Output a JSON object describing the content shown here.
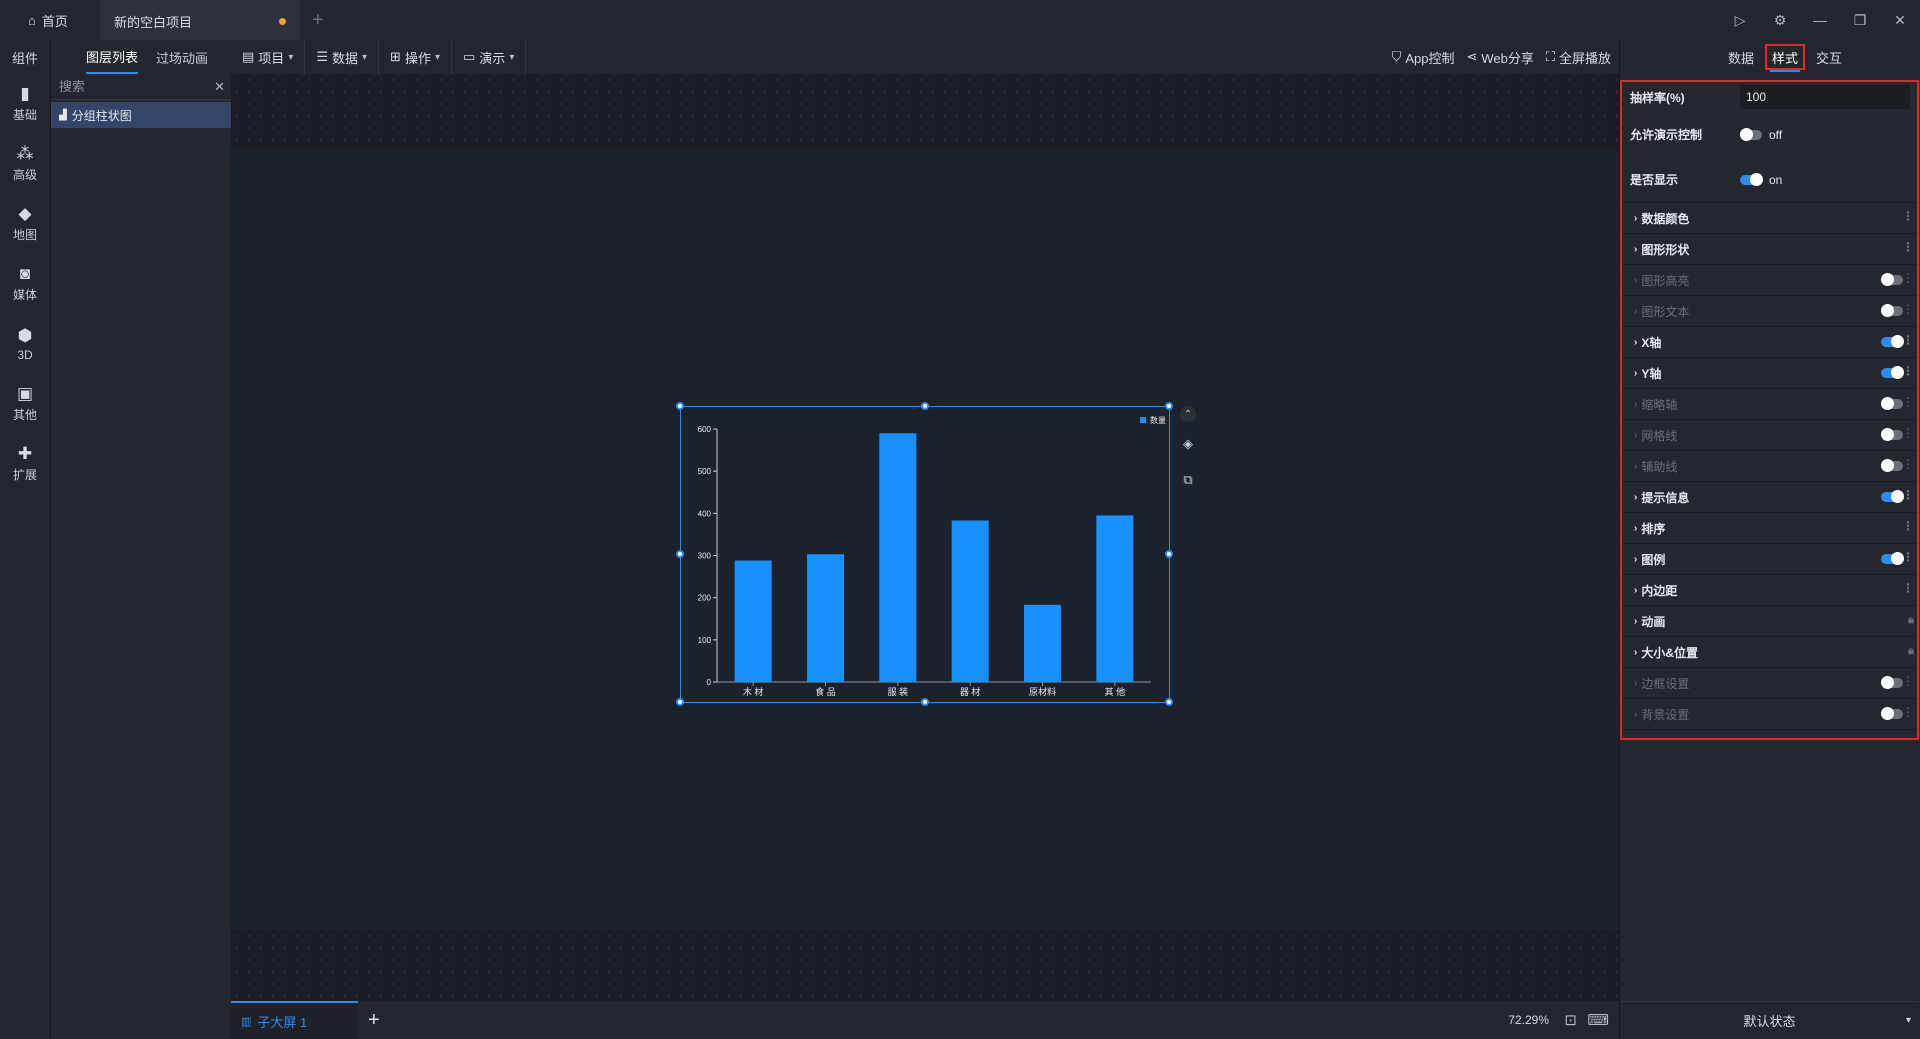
{
  "titlebar": {
    "home_label": "首页",
    "project_label": "新的空白项目",
    "add_tab": "+"
  },
  "leftbar": {
    "title": "组件",
    "items": [
      {
        "label": "基础",
        "icon": "bar-chart-icon"
      },
      {
        "label": "高级",
        "icon": "scatter-icon"
      },
      {
        "label": "地图",
        "icon": "map-icon"
      },
      {
        "label": "媒体",
        "icon": "camera-icon"
      },
      {
        "label": "3D",
        "icon": "cube-icon"
      },
      {
        "label": "其他",
        "icon": "image-icon"
      },
      {
        "label": "扩展",
        "icon": "puzzle-icon"
      }
    ]
  },
  "layer_panel": {
    "tabs": [
      "图层列表",
      "过场动画"
    ],
    "search_placeholder": "搜索",
    "layers": [
      "分组柱状图"
    ]
  },
  "toolbar": {
    "menus": [
      "项目",
      "数据",
      "操作",
      "演示"
    ],
    "app_control": "App控制",
    "web_share": "Web分享",
    "fullscreen": "全屏播放"
  },
  "chart_data": {
    "type": "bar",
    "categories": [
      "木 材",
      "食 品",
      "服 装",
      "器 材",
      "原材料",
      "其 他"
    ],
    "series": [
      {
        "name": "数量",
        "values": [
          288,
          303,
          590,
          383,
          183,
          395
        ]
      }
    ],
    "ylim": [
      0,
      600
    ],
    "yticks": [
      0,
      100,
      200,
      300,
      400,
      500,
      600
    ],
    "legend": "top-right",
    "grid": false,
    "color": "#1890ff"
  },
  "bottombar": {
    "screen_tab": "子大屏 1",
    "add": "+",
    "zoom": "72.29%"
  },
  "right_panel": {
    "tabs": [
      "数据",
      "样式",
      "交互"
    ],
    "active_tab": "样式",
    "sample_rate_label": "抽样率(%)",
    "sample_rate_value": "100",
    "demo_control_label": "允许演示控制",
    "demo_control_state": "off",
    "show_label": "是否显示",
    "show_state": "on",
    "sections": [
      {
        "label": "数据颜色",
        "enabled": true,
        "control": "menu"
      },
      {
        "label": "图形形状",
        "enabled": true,
        "control": "menu"
      },
      {
        "label": "图形高亮",
        "enabled": false,
        "control": "toggle-off"
      },
      {
        "label": "图形文本",
        "enabled": false,
        "control": "toggle-off"
      },
      {
        "label": "X轴",
        "enabled": true,
        "control": "toggle-on"
      },
      {
        "label": "Y轴",
        "enabled": true,
        "control": "toggle-on"
      },
      {
        "label": "缩略轴",
        "enabled": false,
        "control": "toggle-off"
      },
      {
        "label": "网格线",
        "enabled": false,
        "control": "toggle-off"
      },
      {
        "label": "辅助线",
        "enabled": false,
        "control": "toggle-off"
      },
      {
        "label": "提示信息",
        "enabled": true,
        "control": "toggle-on"
      },
      {
        "label": "排序",
        "enabled": true,
        "control": "menu"
      },
      {
        "label": "图例",
        "enabled": true,
        "control": "toggle-on"
      },
      {
        "label": "内边距",
        "enabled": true,
        "control": "menu"
      },
      {
        "label": "动画",
        "enabled": true,
        "control": "lock"
      },
      {
        "label": "大小&位置",
        "enabled": true,
        "control": "lock"
      },
      {
        "label": "边框设置",
        "enabled": false,
        "control": "toggle-off"
      },
      {
        "label": "背景设置",
        "enabled": false,
        "control": "toggle-off"
      }
    ],
    "state_label": "默认状态"
  },
  "colors": {
    "accent": "#2d8cf0",
    "bar": "#1890ff",
    "highlight_border": "#e02a2a",
    "modified_dot": "#e8a04b"
  }
}
